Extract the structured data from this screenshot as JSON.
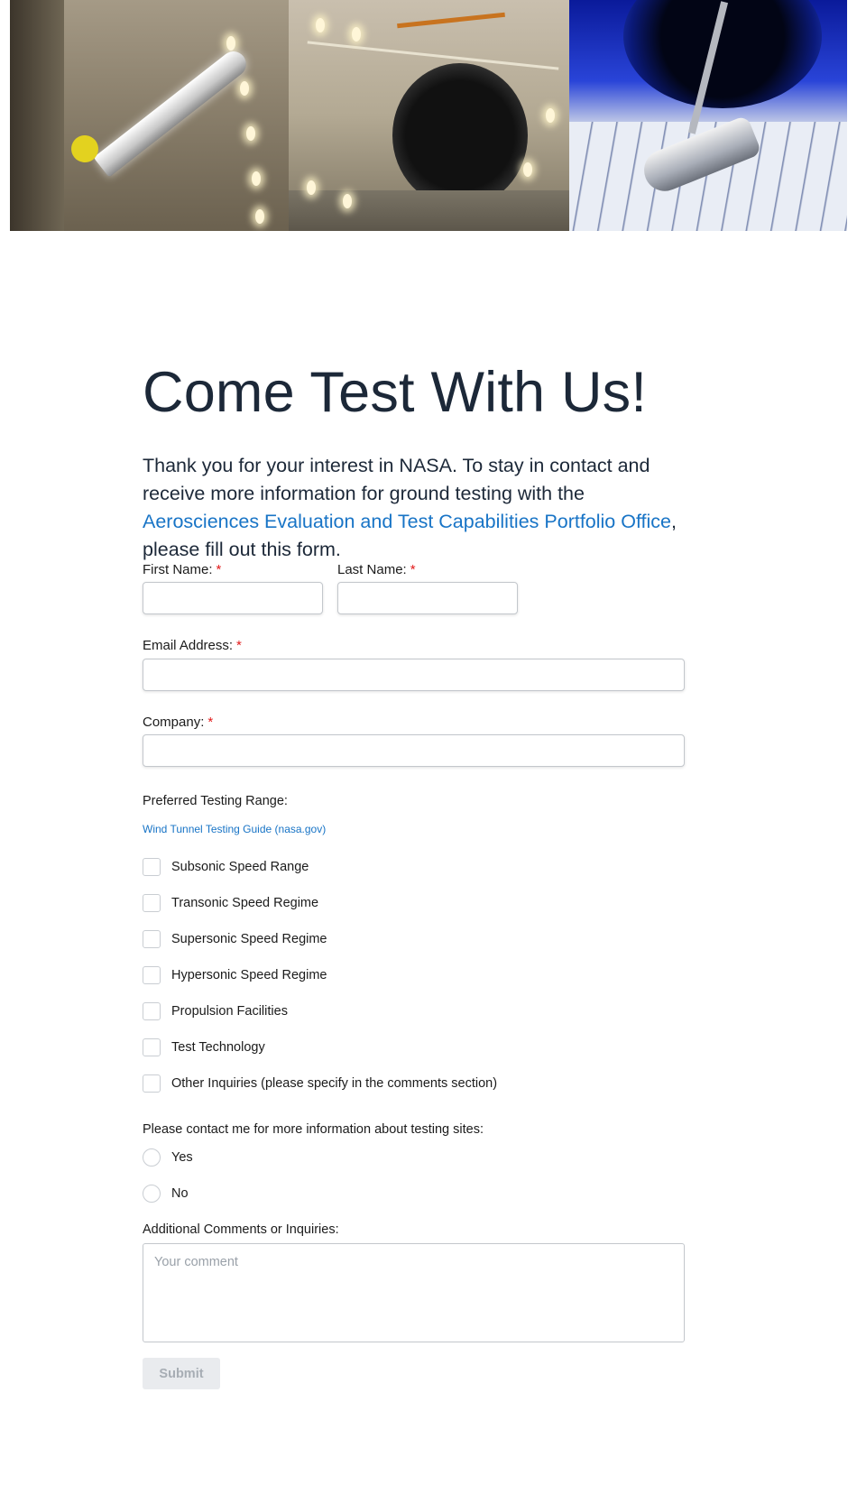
{
  "form": {
    "title": "Come Test With Us!",
    "intro_before": "Thank you for your interest in NASA. To stay in contact and receive more information for ground testing with the ",
    "intro_link": "Aerosciences Evaluation and Test Capabilities Portfolio Office",
    "intro_after": ", please fill out this form.",
    "required_marker": "*",
    "first_name_label": "First Name:",
    "last_name_label": "Last Name:",
    "email_label": "Email Address:",
    "company_label": "Company:",
    "testing_range_label": "Preferred Testing Range:",
    "guide_link": "Wind Tunnel Testing Guide (nasa.gov)",
    "testing_options": [
      "Subsonic Speed Range",
      "Transonic Speed Regime",
      "Supersonic Speed Regime",
      "Hypersonic Speed Regime",
      "Propulsion Facilities",
      "Test Technology",
      "Other Inquiries (please specify in the comments section)"
    ],
    "contact_label": "Please contact me for more information about testing sites:",
    "contact_options": [
      "Yes",
      "No"
    ],
    "comments_label": "Additional Comments or Inquiries:",
    "comments_placeholder": "Your comment",
    "submit_label": "Submit"
  },
  "colors": {
    "title": "#1c2838",
    "link": "#1874c6",
    "required": "#e21a1a",
    "submit_bg": "#e9ebee",
    "submit_text": "#a7adb4"
  }
}
